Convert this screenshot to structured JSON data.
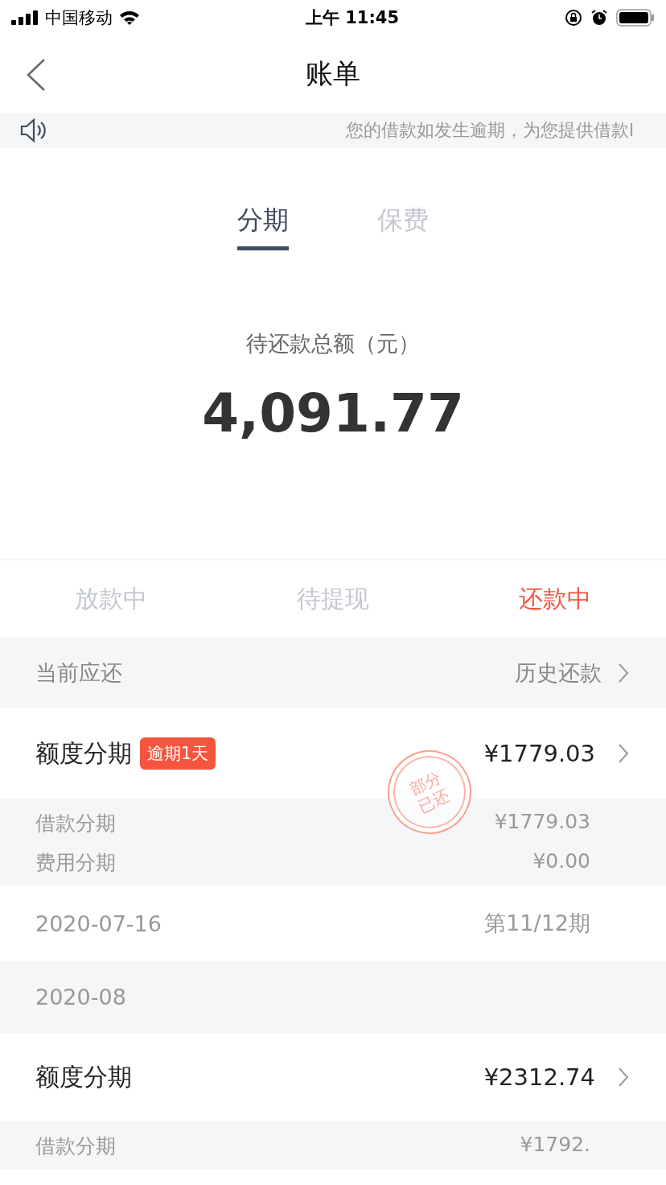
{
  "status_bar": {
    "carrier": "中国移动",
    "time": "上午 11:45"
  },
  "nav": {
    "title": "账单"
  },
  "notice": {
    "text": "您的借款如发生逾期，为您提供借款l"
  },
  "tabs": [
    {
      "label": "分期",
      "selected": true
    },
    {
      "label": "保费",
      "selected": false
    }
  ],
  "summary": {
    "label": "待还款总额（元）",
    "amount": "4,091.77"
  },
  "status_tabs": [
    {
      "label": "放款中",
      "selected": false
    },
    {
      "label": "待提现",
      "selected": false
    },
    {
      "label": "还款中",
      "selected": true
    }
  ],
  "current_header": {
    "title": "当前应还",
    "link": "历史还款"
  },
  "bills": [
    {
      "title": "额度分期",
      "badge": "逾期1天",
      "amount": "¥1779.03",
      "stamp": [
        "部分",
        "已还"
      ],
      "details": [
        {
          "label": "借款分期",
          "value": "¥1779.03"
        },
        {
          "label": "费用分期",
          "value": "¥0.00"
        }
      ],
      "date": "2020-07-16",
      "period": "第11/12期"
    },
    {
      "month": "2020-08",
      "title": "额度分期",
      "amount": "¥2312.74",
      "details": [
        {
          "label": "借款分期",
          "value": "¥1792."
        }
      ]
    }
  ]
}
